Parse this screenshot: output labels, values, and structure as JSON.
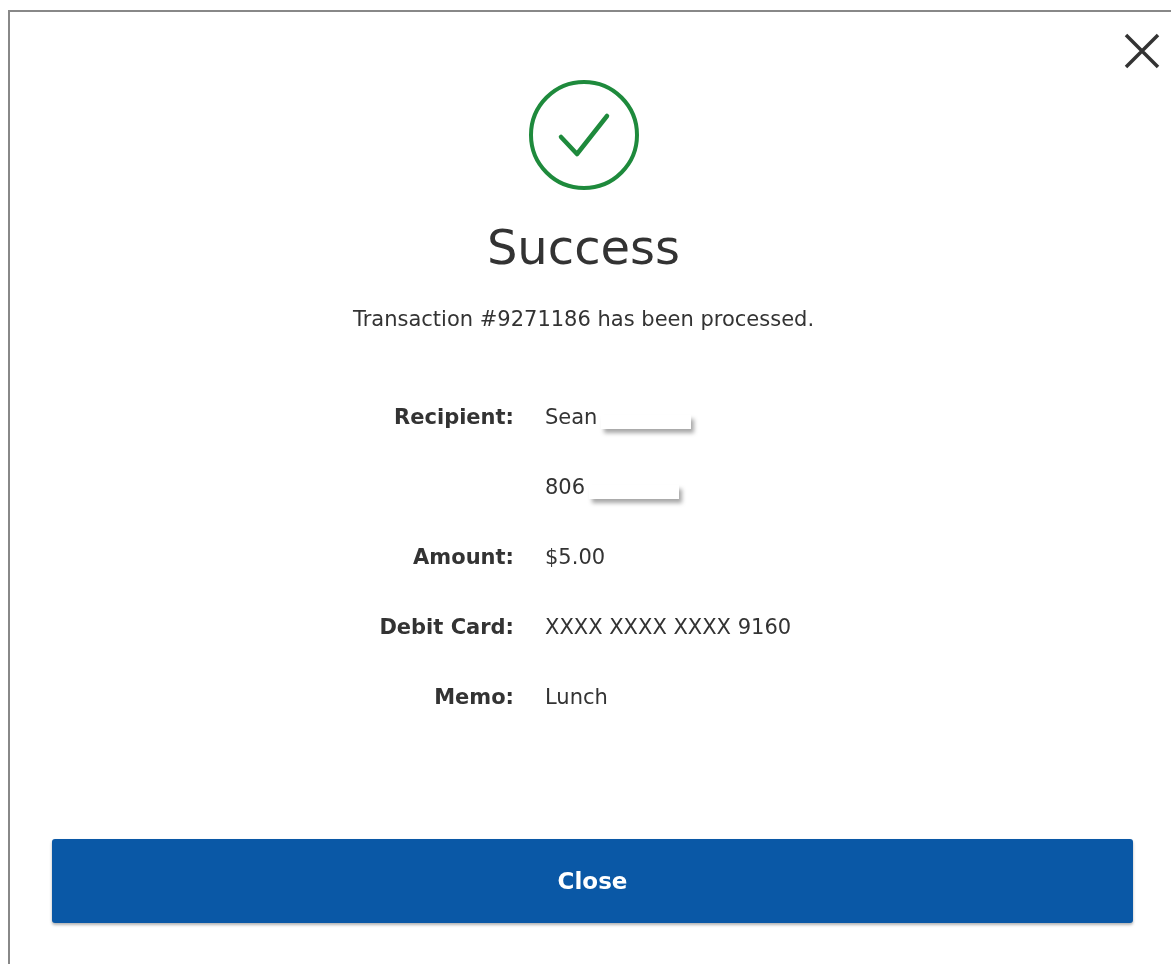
{
  "dialog": {
    "title": "Success",
    "message": "Transaction #9271186 has been processed.",
    "details": [
      {
        "label": "Recipient:",
        "value": "Sean",
        "redacted": true
      },
      {
        "value": "806",
        "redacted": true
      },
      {
        "label": "Amount:",
        "value": "$5.00",
        "redacted": false
      },
      {
        "label": "Debit Card:",
        "value": "XXXX XXXX XXXX 9160",
        "redacted": false
      },
      {
        "label": "Memo:",
        "value": "Lunch",
        "redacted": false
      }
    ],
    "button": "Close"
  }
}
